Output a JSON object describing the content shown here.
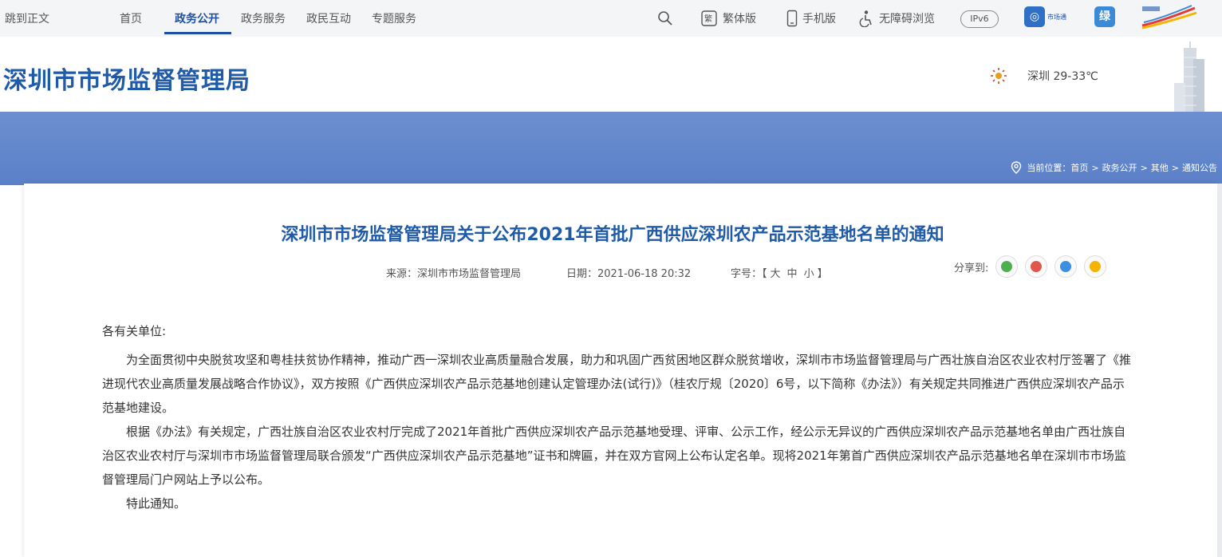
{
  "topnav": {
    "skip": "跳到正文",
    "items": [
      "首页",
      "政务公开",
      "政务服务",
      "政民互动",
      "专题服务"
    ],
    "active_index": 1,
    "tools": {
      "traditional": "繁体版",
      "mobile": "手机版",
      "accessible": "无障碍浏览",
      "ipv6": "IPv6"
    },
    "app_icon_label": "市场通",
    "app_icon2_char": "绿"
  },
  "header": {
    "site_title": "深圳市市场监督管理局",
    "weather": "深圳 29-33℃"
  },
  "breadcrumb": {
    "prefix": "当前位置：",
    "items": [
      "首页",
      "政务公开",
      "其他",
      "通知公告"
    ],
    "separator": ">"
  },
  "article": {
    "title": "深圳市市场监督管理局关于公布2021年首批广西供应深圳农产品示范基地名单的通知",
    "source": "来源：深圳市市场监督管理局",
    "date": "日期：2021-06-18 20:32",
    "fontsize_label": "字号：",
    "fontsize_open": "【",
    "fontsize_large": "大",
    "fontsize_medium": "中",
    "fontsize_small": "小",
    "fontsize_close": "】",
    "share_label": "分享到:",
    "salutation": "各有关单位:",
    "paragraphs": [
      "为全面贯彻中央脱贫攻坚和粤桂扶贫协作精神，推动广西一深圳农业高质量融合发展，助力和巩固广西贫困地区群众脱贫增收，深圳市市场监督管理局与广西壮族自治区农业农村厅签署了《推进现代农业高质量发展战略合作协议》，双方按照《广西供应深圳农产品示范基地创建认定管理办法(试行)》（桂农厅规〔2020〕6号，以下简称《办法》）有关规定共同推进广西供应深圳农产品示范基地建设。",
      "根据《办法》有关规定，广西壮族自治区农业农村厅完成了2021年首批广西供应深圳农产品示范基地受理、评审、公示工作，经公示无异议的广西供应深圳农产品示范基地名单由广西壮族自治区农业农村厅与深圳市市场监督管理局联合颁发“广西供应深圳农产品示范基地”证书和牌匾，并在双方官网上公布认定名单。现将2021年第首广西供应深圳农产品示范基地名单在深圳市市场监督管理局门户网站上予以公布。",
      "特此通知。"
    ]
  },
  "colors": {
    "brand_blue": "#1f5ba8",
    "banner_blue": "#5b80c9",
    "share_wechat": "#4caf50",
    "share_weibo": "#e2574c",
    "share_qq": "#3b8fe0",
    "share_qzone": "#f5b400"
  }
}
